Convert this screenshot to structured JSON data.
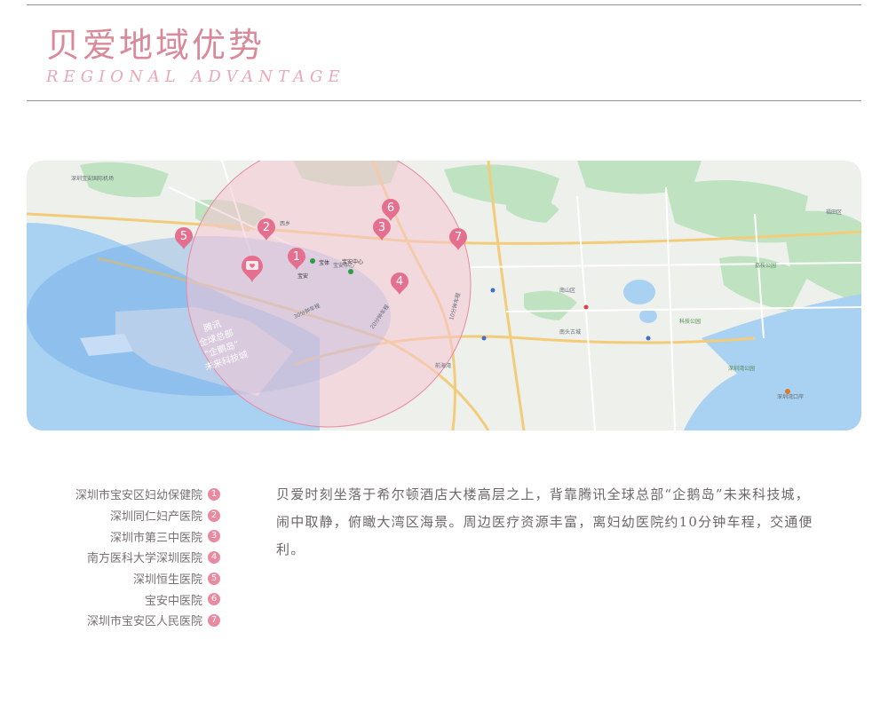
{
  "header": {
    "title_cn": "贝爱地域优势",
    "title_en": "REGIONAL ADVANTAGE"
  },
  "map": {
    "road_labels": [
      "30分钟车程",
      "20分钟车程",
      "10分钟车程"
    ],
    "overlay_text": [
      "腾讯",
      "全球总部",
      "“企鹅岛”",
      "未来科技城"
    ],
    "marker_labels": [
      "宝体",
      "宝安中心",
      "宝安"
    ],
    "place_labels": [
      "深圳宝安国际机场",
      "西乡",
      "宝安中心",
      "前海湾",
      "深圳湾口岸",
      "南山区",
      "南头古城",
      "深圳湾公园",
      "科技公园",
      "荔枝公园",
      "福田区"
    ],
    "colors": {
      "pin": "#e56f8f",
      "radius_fill": "#f6c6d3",
      "sea": "#a9d1f2"
    }
  },
  "legend": {
    "items": [
      {
        "label": "深圳市宝安区妇幼保健院",
        "num": "1"
      },
      {
        "label": "深圳同仁妇产医院",
        "num": "2"
      },
      {
        "label": "深圳市第三中医院",
        "num": "3"
      },
      {
        "label": "南方医科大学深圳医院",
        "num": "4"
      },
      {
        "label": "深圳恒生医院",
        "num": "5"
      },
      {
        "label": "宝安中医院",
        "num": "6"
      },
      {
        "label": "深圳市宝安区人民医院",
        "num": "7"
      }
    ]
  },
  "description": "贝爱时刻坐落于希尔顿酒店大楼高层之上，背靠腾讯全球总部“企鹅岛”未来科技城，闹中取静，俯瞰大湾区海景。周边医疗资源丰富，离妇幼医院约10分钟车程，交通便利。"
}
